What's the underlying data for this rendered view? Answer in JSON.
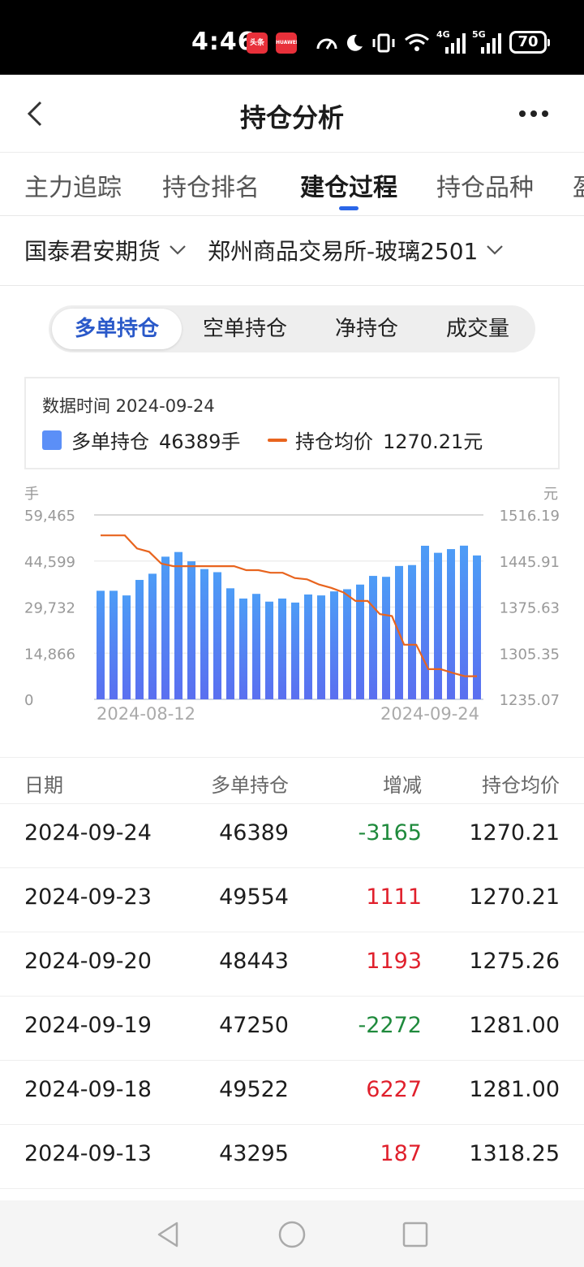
{
  "status_bar": {
    "time": "4:46",
    "app_badges": [
      "头条",
      "HUAWEI"
    ],
    "network_1": "4G",
    "network_2": "5G",
    "battery": "70"
  },
  "header": {
    "title": "持仓分析"
  },
  "tabs": [
    {
      "label": "主力追踪",
      "active": false
    },
    {
      "label": "持仓排名",
      "active": false
    },
    {
      "label": "建仓过程",
      "active": true
    },
    {
      "label": "持仓品种",
      "active": false
    },
    {
      "label": "盈",
      "active": false
    }
  ],
  "selectors": {
    "broker": "国泰君安期货",
    "contract": "郑州商品交易所-玻璃2501"
  },
  "segments": [
    {
      "label": "多单持仓",
      "active": true
    },
    {
      "label": "空单持仓",
      "active": false
    },
    {
      "label": "净持仓",
      "active": false
    },
    {
      "label": "成交量",
      "active": false
    }
  ],
  "legend": {
    "time_label": "数据时间 2024-09-24",
    "bar_label": "多单持仓",
    "bar_value": "46389手",
    "line_label": "持仓均价",
    "line_value": "1270.21元",
    "bar_color": "#5b8ff7",
    "line_color": "#e8641e"
  },
  "chart_data": {
    "type": "bar",
    "left_unit": "手",
    "right_unit": "元",
    "left_ticks": [
      "59,465",
      "44,599",
      "29,732",
      "14,866",
      "0"
    ],
    "right_ticks": [
      "1516.19",
      "1445.91",
      "1375.63",
      "1305.35",
      "1235.07"
    ],
    "ylim_left": [
      0,
      59465
    ],
    "ylim_right": [
      1235.07,
      1516.19
    ],
    "x_start_label": "2024-08-12",
    "x_end_label": "2024-09-24",
    "series": [
      {
        "name": "多单持仓",
        "kind": "bar",
        "values": [
          35000,
          35000,
          33500,
          38500,
          40500,
          46000,
          47500,
          44500,
          42000,
          41000,
          35800,
          32500,
          34000,
          31500,
          32500,
          31200,
          33800,
          33500,
          34800,
          35500,
          37000,
          39800,
          39500,
          43000,
          43295,
          49522,
          47250,
          48443,
          49554,
          46389
        ]
      },
      {
        "name": "持仓均价",
        "kind": "line",
        "values": [
          1485,
          1485,
          1485,
          1465,
          1460,
          1442,
          1438,
          1438,
          1438,
          1438,
          1438,
          1438,
          1432,
          1432,
          1428,
          1428,
          1420,
          1418,
          1410,
          1405,
          1398,
          1385,
          1385,
          1365,
          1362,
          1318.25,
          1318.25,
          1281,
          1281,
          1275.26,
          1270.21,
          1270.21
        ]
      }
    ]
  },
  "table": {
    "headers": [
      "日期",
      "多单持仓",
      "增减",
      "持仓均价"
    ],
    "rows": [
      {
        "date": "2024-09-24",
        "long": "46389",
        "change": "-3165",
        "avg": "1270.21",
        "dir": "neg"
      },
      {
        "date": "2024-09-23",
        "long": "49554",
        "change": "1111",
        "avg": "1270.21",
        "dir": "pos"
      },
      {
        "date": "2024-09-20",
        "long": "48443",
        "change": "1193",
        "avg": "1275.26",
        "dir": "pos"
      },
      {
        "date": "2024-09-19",
        "long": "47250",
        "change": "-2272",
        "avg": "1281.00",
        "dir": "neg"
      },
      {
        "date": "2024-09-18",
        "long": "49522",
        "change": "6227",
        "avg": "1281.00",
        "dir": "pos"
      },
      {
        "date": "2024-09-13",
        "long": "43295",
        "change": "187",
        "avg": "1318.25",
        "dir": "pos"
      }
    ]
  },
  "colors": {
    "accent": "#2a66e8",
    "positive": "#e0202c",
    "negative": "#1f8a3c"
  }
}
